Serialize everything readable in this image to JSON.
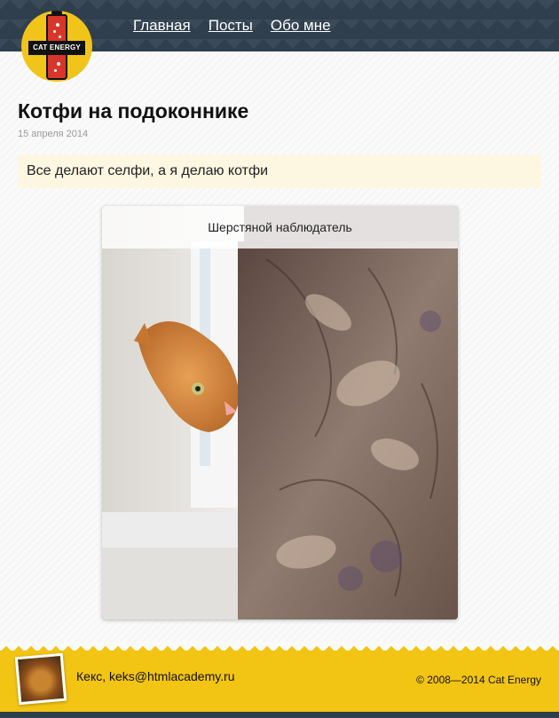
{
  "header": {
    "logo_text": "CAT ENERGY",
    "nav": [
      {
        "label": "Главная"
      },
      {
        "label": "Посты"
      },
      {
        "label": "Обо мне"
      }
    ]
  },
  "post": {
    "title": "Котфи на подоконнике",
    "date": "15 апреля 2014",
    "quote": "Все делают селфи, а я делаю котфи",
    "figure_caption": "Шерстяной наблюдатель"
  },
  "footer": {
    "contact": "Кекс, keks@htmlacademy.ru",
    "copyright": "© 2008—2014 Cat Energy"
  },
  "colors": {
    "header_bg": "#2f3f4e",
    "accent_yellow": "#f2c413",
    "quote_bg": "#fdf6e1"
  }
}
